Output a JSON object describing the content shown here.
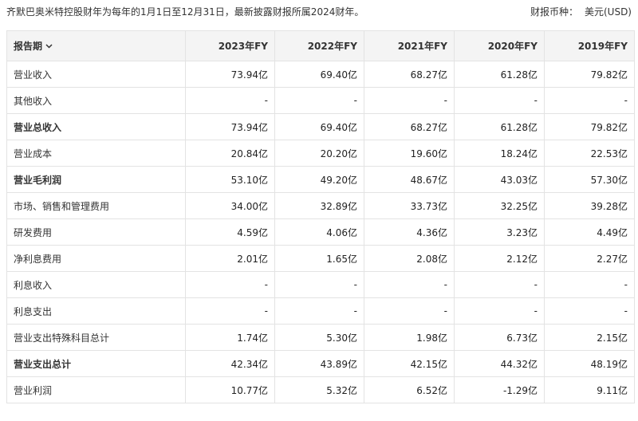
{
  "header": {
    "note": "齐默巴奥米特控股财年为每年的1月1日至12月31日，最新披露财报所属2024财年。",
    "currency_label": "财报币种：",
    "currency_value": "美元(USD)"
  },
  "table": {
    "period_header": "报告期",
    "columns": [
      "2023年FY",
      "2022年FY",
      "2021年FY",
      "2020年FY",
      "2019年FY"
    ],
    "rows": [
      {
        "label": "营业收入",
        "bold": false,
        "values": [
          "73.94亿",
          "69.40亿",
          "68.27亿",
          "61.28亿",
          "79.82亿"
        ]
      },
      {
        "label": "其他收入",
        "bold": false,
        "values": [
          "-",
          "-",
          "-",
          "-",
          "-"
        ]
      },
      {
        "label": "营业总收入",
        "bold": true,
        "values": [
          "73.94亿",
          "69.40亿",
          "68.27亿",
          "61.28亿",
          "79.82亿"
        ]
      },
      {
        "label": "营业成本",
        "bold": false,
        "values": [
          "20.84亿",
          "20.20亿",
          "19.60亿",
          "18.24亿",
          "22.53亿"
        ]
      },
      {
        "label": "营业毛利润",
        "bold": true,
        "values": [
          "53.10亿",
          "49.20亿",
          "48.67亿",
          "43.03亿",
          "57.30亿"
        ]
      },
      {
        "label": "市场、销售和管理费用",
        "bold": false,
        "values": [
          "34.00亿",
          "32.89亿",
          "33.73亿",
          "32.25亿",
          "39.28亿"
        ]
      },
      {
        "label": "研发费用",
        "bold": false,
        "values": [
          "4.59亿",
          "4.06亿",
          "4.36亿",
          "3.23亿",
          "4.49亿"
        ]
      },
      {
        "label": "净利息费用",
        "bold": false,
        "values": [
          "2.01亿",
          "1.65亿",
          "2.08亿",
          "2.12亿",
          "2.27亿"
        ]
      },
      {
        "label": "利息收入",
        "bold": false,
        "values": [
          "-",
          "-",
          "-",
          "-",
          "-"
        ]
      },
      {
        "label": "利息支出",
        "bold": false,
        "values": [
          "-",
          "-",
          "-",
          "-",
          "-"
        ]
      },
      {
        "label": "营业支出特殊科目总计",
        "bold": false,
        "values": [
          "1.74亿",
          "5.30亿",
          "1.98亿",
          "6.73亿",
          "2.15亿"
        ]
      },
      {
        "label": "营业支出总计",
        "bold": true,
        "values": [
          "42.34亿",
          "43.89亿",
          "42.15亿",
          "44.32亿",
          "48.19亿"
        ]
      },
      {
        "label": "营业利润",
        "bold": false,
        "values": [
          "10.77亿",
          "5.32亿",
          "6.52亿",
          "-1.29亿",
          "9.11亿"
        ]
      }
    ]
  },
  "icons": {
    "period_dropdown": "chevron-down-icon"
  }
}
